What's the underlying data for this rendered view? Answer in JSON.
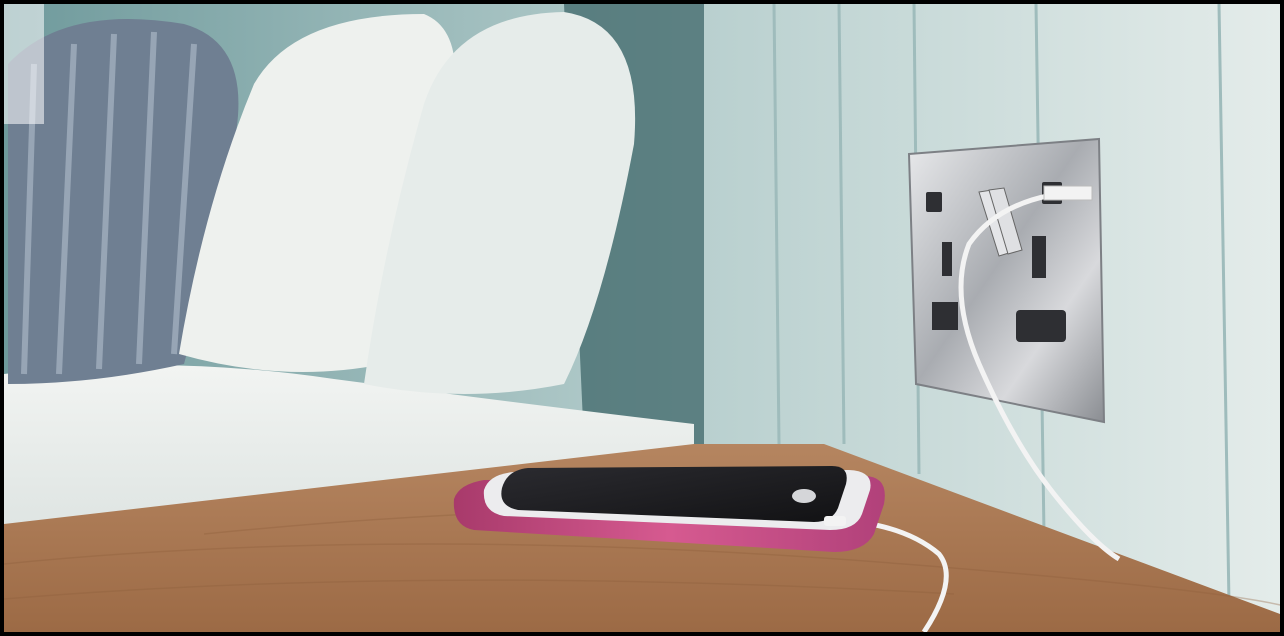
{
  "scene": {
    "subject": "phone-charging-on-bedside-table",
    "colors": {
      "wall": "#d9e6e4",
      "wall_shadow": "#8fb3b3",
      "table": "#a8774f",
      "phone_case": "#c8467f",
      "screen": "#1c1c1f",
      "socket_plate": "#c9cbcf",
      "cable": "#f3f3f3",
      "pillow": "#eef1ee",
      "striped_pillow": "#6f7f92"
    }
  }
}
